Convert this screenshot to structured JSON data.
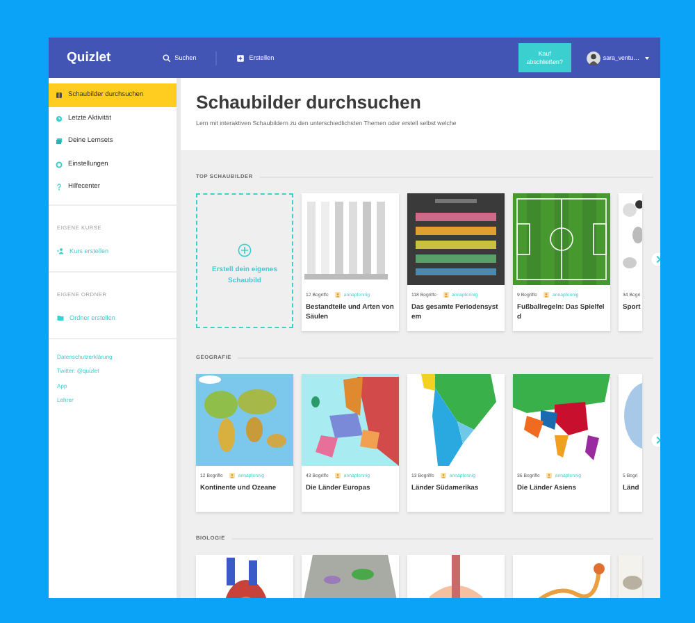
{
  "topbar": {
    "logo": "Quizlet",
    "search": "Suchen",
    "create": "Erstellen",
    "buy_button": "Kauf abschließen?",
    "username": "sara_ventu…"
  },
  "sidebar": {
    "nav": [
      {
        "label": "Schaubilder durchsuchen",
        "selected": true
      },
      {
        "label": "Letzte Aktivität",
        "selected": false
      },
      {
        "label": "Deine Lernsets",
        "selected": false
      },
      {
        "label": "Einstellungen",
        "selected": false
      },
      {
        "label": "Hilfecenter",
        "selected": false
      }
    ],
    "groups": [
      {
        "title": "EIGENE KURSE",
        "action": "Kurs erstellen"
      },
      {
        "title": "EIGENE ORDNER",
        "action": "Ordner erstellen"
      }
    ],
    "links": [
      "Datenschutzerklärung",
      "Twitter: @quizlet",
      "App",
      "Lehrer"
    ]
  },
  "page": {
    "title": "Schaubilder durchsuchen",
    "subtitle": "Lern mit interaktiven Schaubildern zu den unterschiedlichsten Themen oder erstell selbst welche"
  },
  "sections": [
    {
      "title": "TOP SCHAUBILDER",
      "create_card": "Erstell dein eigenes Schaubild",
      "next_arrow": true,
      "cards": [
        {
          "kind": "set",
          "cut": false,
          "count": "12 Begriffe",
          "author": "annapfennig",
          "title": "Bestandteile und Arten von Säulen"
        },
        {
          "kind": "set",
          "cut": false,
          "count": "118 Begriffe",
          "author": "annapfennig",
          "title": "Das gesamte Periodensystem"
        },
        {
          "kind": "set",
          "cut": false,
          "count": "9 Begriffe",
          "author": "annapfennig",
          "title": "Fußballregeln: Das Spielfeld"
        },
        {
          "kind": "set",
          "cut": true,
          "count": "34 Begri",
          "title": "Sport"
        }
      ]
    },
    {
      "title": "GEOGRAFIE",
      "next_arrow": true,
      "cards": [
        {
          "kind": "set",
          "cut": false,
          "count": "12 Begriffe",
          "author": "annapfennig",
          "title": "Kontinente und Ozeane"
        },
        {
          "kind": "set",
          "cut": false,
          "count": "43 Begriffe",
          "author": "annapfennig",
          "title": "Die Länder Europas"
        },
        {
          "kind": "set",
          "cut": false,
          "count": "13 Begriffe",
          "author": "annapfennig",
          "title": "Länder Südamerikas"
        },
        {
          "kind": "set",
          "cut": false,
          "count": "36 Begriffe",
          "author": "annapfennig",
          "title": "Die Länder Asiens"
        },
        {
          "kind": "set",
          "cut": true,
          "count": "5 Begri",
          "title": "Länd"
        }
      ]
    },
    {
      "title": "BIOLOGIE",
      "next_arrow": false,
      "cards": [
        {
          "kind": "picture",
          "cut": false
        },
        {
          "kind": "picture",
          "cut": false
        },
        {
          "kind": "picture",
          "cut": false
        },
        {
          "kind": "picture",
          "cut": false
        },
        {
          "kind": "picture",
          "cut": true
        }
      ]
    }
  ]
}
